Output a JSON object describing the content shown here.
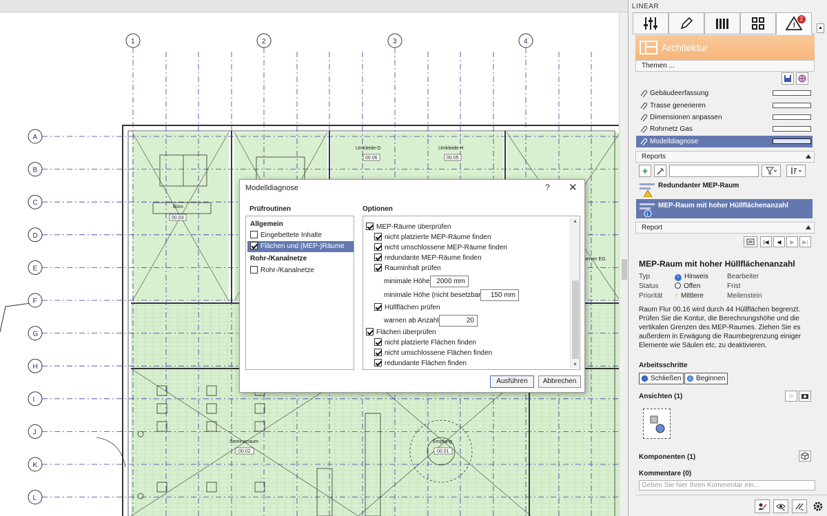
{
  "canvas": {
    "grid_columns": [
      "1",
      "2",
      "3",
      "4"
    ],
    "grid_rows": [
      "A",
      "B",
      "C",
      "D",
      "E",
      "F",
      "G",
      "H",
      "I",
      "J",
      "K",
      "L"
    ],
    "rooms": [
      {
        "name": "Büro",
        "tag": "00.03"
      },
      {
        "name": "Umkleide-D",
        "tag": "00.06"
      },
      {
        "name": "Umkleide-H",
        "tag": "00.05"
      },
      {
        "name": "Server EG",
        "tag": ""
      },
      {
        "name": "Seminarraum",
        "tag": "00.02"
      },
      {
        "name": "Empfang",
        "tag": "00.01"
      }
    ]
  },
  "dialog": {
    "title": "Modelldiagnose",
    "help": "?",
    "close": "✕",
    "routines_label": "Prüfroutinen",
    "options_label": "Optionen",
    "routines": [
      {
        "label": "Allgemein",
        "group": true
      },
      {
        "label": "Eingebettete Inhalte",
        "checked": false,
        "selected": false
      },
      {
        "label": "Flächen und (MEP-)Räume",
        "checked": true,
        "selected": true
      },
      {
        "label": "Rohr-/Kanalnetze",
        "group": true
      },
      {
        "label": "Rohr-/Kanalnetze",
        "checked": false,
        "selected": false
      }
    ],
    "options": {
      "mep_check": "MEP-Räume überprüfen",
      "mep_unplaced": "nicht platzierte MEP-Räume finden",
      "mep_unclosed": "nicht umschlossene MEP-Räume finden",
      "mep_redundant": "redundante MEP-Räume finden",
      "volume_check": "Rauminhalt prüfen",
      "min_height_label": "minimale Höhe",
      "min_height_value": "2000 mm",
      "min_height_unused_label": "minimale Höhe (nicht besetzbar)",
      "min_height_unused_value": "150 mm",
      "hull_check": "Hüllflächen prüfen",
      "warn_from_label": "warnen ab Anzahl",
      "warn_from_value": "20",
      "areas_check": "Flächen überprüfen",
      "areas_unplaced": "nicht platzierte Flächen finden",
      "areas_unclosed": "nicht umschlossene Flächen finden",
      "areas_redundant": "redundante Flächen finden"
    },
    "run_button": "Ausführen",
    "cancel_button": "Abbrechen"
  },
  "panel": {
    "title": "LINEAR",
    "alert_count": "2",
    "discipline": "Architektur",
    "themes_header": "Themen ...",
    "themes": [
      {
        "label": "Gebäudeerfassung",
        "selected": false
      },
      {
        "label": "Trasse generieren",
        "selected": false
      },
      {
        "label": "Dimensionen anpassen",
        "selected": false
      },
      {
        "label": "Rohrnetz Gas",
        "selected": false
      },
      {
        "label": "Modelldiagnose",
        "selected": true
      }
    ],
    "reports_header": "Reports",
    "reports": [
      {
        "label": "Redundanter MEP-Raum",
        "selected": false
      },
      {
        "label": "MEP-Raum mit hoher Hüllflächenanzahl",
        "selected": true
      }
    ],
    "report_header": "Report",
    "report": {
      "title": "MEP-Raum mit hoher Hüllflächenanzahl",
      "type_key": "Typ",
      "type_val": "Hinweis",
      "type_extra": "Bearbeiter",
      "status_key": "Status",
      "status_val": "Offen",
      "status_extra": "Frist",
      "priority_key": "Priorität",
      "priority_val": "Mittlere",
      "priority_extra": "Meilenstein",
      "description": "Raum Flur 00.16 wird durch 44 Hüllflächen begrenzt. Prüfen Sie die Kontur, die Berechnungshöhe und die vertikalen Grenzen des MEP-Raumes. Ziehen Sie es außerdem in Erwägung die Raumbegrenzung einiger Elemente wie Säulen etc. zu deaktivieren.",
      "steps_label": "Arbeitsschritte",
      "step_close": "Schließen",
      "step_begin": "Beginnen",
      "views_label": "Ansichten (1)",
      "components_label": "Komponenten (1)",
      "comments_label": "Kommentare (0)",
      "comment_placeholder": "Geben Sie hier Ihren Kommentar ein..."
    }
  },
  "colors": {
    "accent_selected": "#6478b0",
    "banner_orange": "#f6b67a",
    "room_fill": "#d8f0cf",
    "grid_line": "#3a3aa8",
    "alert_red": "#d02b2b"
  }
}
